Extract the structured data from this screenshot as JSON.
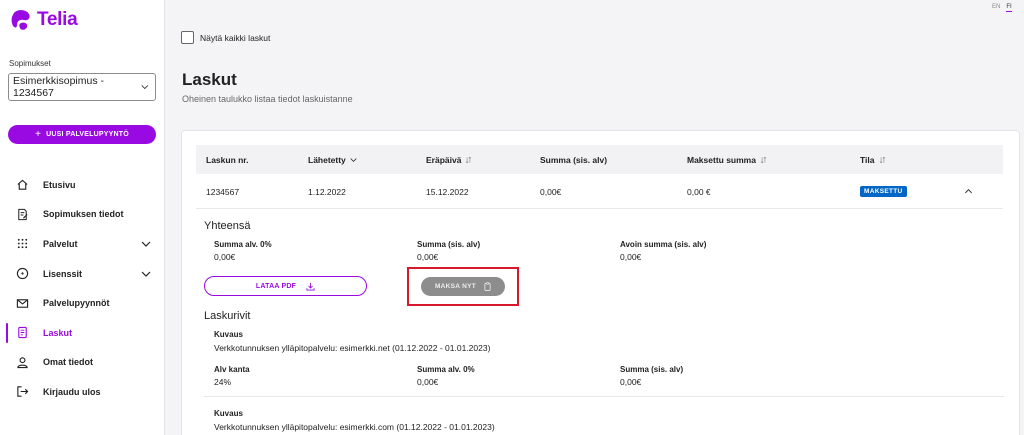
{
  "brand": {
    "name": "Telia",
    "color": "#990ae3"
  },
  "language": {
    "options": [
      "EN",
      "FI"
    ],
    "active": "FI"
  },
  "sidebar": {
    "contract_label": "Sopimukset",
    "contract_value": "Esimerkkisopimus - 1234567",
    "new_request_label": "UUSI PALVELUPYYNTÖ",
    "items": [
      {
        "label": "Etusivu",
        "icon": "home-icon"
      },
      {
        "label": "Sopimuksen tiedot",
        "icon": "document-edit-icon"
      },
      {
        "label": "Palvelut",
        "icon": "grid-dots-icon",
        "expandable": true
      },
      {
        "label": "Lisenssit",
        "icon": "circle-dot-icon",
        "expandable": true
      },
      {
        "label": "Palvelupyynnöt",
        "icon": "mail-icon"
      },
      {
        "label": "Laskut",
        "icon": "invoice-icon",
        "active": true
      },
      {
        "label": "Omat tiedot",
        "icon": "user-icon"
      },
      {
        "label": "Kirjaudu ulos",
        "icon": "logout-icon"
      }
    ]
  },
  "filter": {
    "show_all_label": "Näytä kaikki laskut",
    "checked": false
  },
  "page": {
    "title": "Laskut",
    "subtitle": "Oheinen taulukko listaa tiedot laskuistanne"
  },
  "table": {
    "columns": [
      "Laskun nr.",
      "Lähetetty",
      "Eräpäivä",
      "Summa (sis. alv)",
      "Maksettu summa",
      "Tila"
    ],
    "rows": [
      {
        "invoice_no": "1234567",
        "sent": "1.12.2022",
        "due": "15.12.2022",
        "sum": "0,00€",
        "paid": "0,00 €",
        "status": "MAKSETTU",
        "status_color": "#0067c7"
      }
    ]
  },
  "details": {
    "totals_title": "Yhteensä",
    "totals": [
      {
        "label": "Summa alv. 0%",
        "value": "0,00€"
      },
      {
        "label": "Summa (sis. alv)",
        "value": "0,00€"
      },
      {
        "label": "Avoin summa (sis. alv)",
        "value": "0,00€"
      }
    ],
    "pdf_button": "LATAA PDF",
    "pay_button": "MAKSA NYT",
    "lines_title": "Laskurivit",
    "lines": [
      {
        "desc_label": "Kuvaus",
        "desc": "Verkkotunnuksen ylläpitopalvelu: esimerkki.net (01.12.2022 - 01.01.2023)",
        "vat_rate_label": "Alv kanta",
        "vat_rate": "24%",
        "sum_ex_label": "Summa alv. 0%",
        "sum_ex": "0,00€",
        "sum_inc_label": "Summa (sis. alv)",
        "sum_inc": "0,00€"
      },
      {
        "desc_label": "Kuvaus",
        "desc": "Verkkotunnuksen ylläpitopalvelu: esimerkki.com (01.12.2022 - 01.01.2023)"
      }
    ]
  }
}
